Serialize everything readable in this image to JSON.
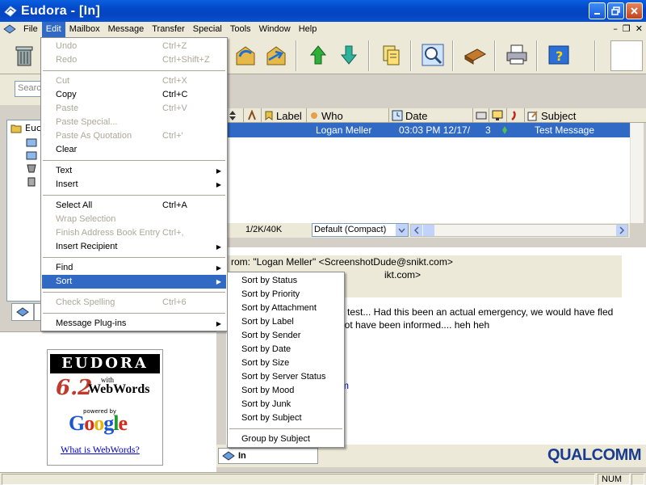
{
  "window": {
    "title": "Eudora - [In]"
  },
  "menubar": [
    "File",
    "Edit",
    "Mailbox",
    "Message",
    "Transfer",
    "Special",
    "Tools",
    "Window",
    "Help"
  ],
  "search": {
    "placeholder": "Search"
  },
  "edit_menu": {
    "items": [
      {
        "label": "Undo",
        "shortcut": "Ctrl+Z",
        "disabled": true
      },
      {
        "label": "Redo",
        "shortcut": "Ctrl+Shift+Z",
        "disabled": true
      },
      {
        "label": "Cut",
        "shortcut": "Ctrl+X",
        "disabled": true
      },
      {
        "label": "Copy",
        "shortcut": "Ctrl+C",
        "disabled": false
      },
      {
        "label": "Paste",
        "shortcut": "Ctrl+V",
        "disabled": true
      },
      {
        "label": "Paste Special...",
        "shortcut": "",
        "disabled": true
      },
      {
        "label": "Paste As Quotation",
        "shortcut": "Ctrl+'",
        "disabled": true
      },
      {
        "label": "Clear",
        "shortcut": "",
        "disabled": false
      },
      {
        "label": "Text",
        "shortcut": "",
        "disabled": false,
        "submenu": true
      },
      {
        "label": "Insert",
        "shortcut": "",
        "disabled": false,
        "submenu": true
      },
      {
        "label": "Select All",
        "shortcut": "Ctrl+A",
        "disabled": false
      },
      {
        "label": "Wrap Selection",
        "shortcut": "",
        "disabled": true
      },
      {
        "label": "Finish Address Book Entry",
        "shortcut": "Ctrl+,",
        "disabled": true
      },
      {
        "label": "Insert Recipient",
        "shortcut": "",
        "disabled": false,
        "submenu": true
      },
      {
        "label": "Find",
        "shortcut": "",
        "disabled": false,
        "submenu": true
      },
      {
        "label": "Sort",
        "shortcut": "",
        "disabled": false,
        "submenu": true
      },
      {
        "label": "Check Spelling",
        "shortcut": "Ctrl+6",
        "disabled": true
      },
      {
        "label": "Message Plug-ins",
        "shortcut": "",
        "disabled": false,
        "submenu": true
      }
    ]
  },
  "sort_menu": {
    "items": [
      "Sort by Status",
      "Sort by Priority",
      "Sort by Attachment",
      "Sort by Label",
      "Sort by Sender",
      "Sort by Date",
      "Sort by Size",
      "Sort by Server Status",
      "Sort by Mood",
      "Sort by Junk",
      "Sort by Subject"
    ],
    "group": "Group by Subject"
  },
  "tree": {
    "root_label": "Euc"
  },
  "columns": {
    "label": "Label",
    "who": "Who",
    "date": "Date",
    "subject": "Subject"
  },
  "message": {
    "who": "Logan Meller",
    "date": "03:03 PM 12/17/",
    "size": "3",
    "subject": "Test Message"
  },
  "list_status": {
    "size_info": "1/2K/40K",
    "view": "Default (Compact)"
  },
  "preview": {
    "from_line": "rom: \"Logan Meller\" <ScreenshotDude@snikt.com>",
    "to_fragment": "ikt.com>",
    "body_line1": "a test... Had this been an actual emergency, we would have fled",
    "body_line2": "not have been informed.... heh heh",
    "link_fragment": "m"
  },
  "ad": {
    "brand": "EUDORA",
    "version": "6.2",
    "with": "with",
    "product": "WebWords",
    "powered_by": "powered by",
    "google": "Google",
    "link": "What is WebWords?"
  },
  "bottom": {
    "mailbox_tab": "In",
    "logo": "QUALCOMM"
  },
  "statusbar": {
    "num": "NUM"
  }
}
